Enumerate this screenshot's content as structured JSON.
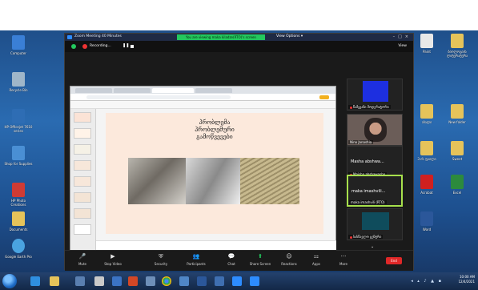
{
  "zoom": {
    "window_title": "Zoom Meeting 40 Minutes",
    "share_banner": "You are viewing maka kiladze(RTO)'s screen",
    "view_options": "View Options ▾",
    "recording_label": "Recording...",
    "view_label": "View"
  },
  "slide": {
    "title": "პრობლემა\nპრობლემური\nგამოწვევები"
  },
  "participants": [
    {
      "name": "წამყვანი მოდერატორი"
    },
    {
      "name": "Nino Janashia"
    },
    {
      "name": "Maisha abshawasho",
      "big": "Masha  abshwa..."
    },
    {
      "name": "maka  imashvili (RTO)",
      "big": "maka  imashvili..."
    },
    {
      "name": "სასწავლო ცენტრი"
    }
  ],
  "toolbar": {
    "mute": "Mute",
    "stop_video": "Stop Video",
    "security": "Security",
    "participants": "Participants",
    "participants_count": "7",
    "chat": "Chat",
    "share_screen": "Share Screen",
    "reactions": "Reactions",
    "apps": "Apps",
    "more": "More",
    "end": "End"
  },
  "desktop_icons_left": [
    {
      "label": "Computer",
      "color": "#3a7fd6"
    },
    {
      "label": "Recycle Bin",
      "color": "#9fb6c9"
    },
    {
      "label": "HP Officejet 7610 series",
      "color": "#2e6db4"
    },
    {
      "label": "Shop for Supplies",
      "color": "#4a8fd4"
    },
    {
      "label": "HP Photo Creations",
      "color": "#cf3b34"
    },
    {
      "label": "Documents",
      "color": "#e5c35a"
    },
    {
      "label": "Google Earth Pro",
      "color": "#4aa3e0"
    }
  ],
  "desktop_icons_right": [
    {
      "label": "Paint",
      "color": "#e8e8e8"
    },
    {
      "label": "ბიოლოგიის ლიტერატურა",
      "color": "#e5c35a"
    },
    {
      "label": "ახალი",
      "color": "#e5c35a"
    },
    {
      "label": "New folder",
      "color": "#e5c35a"
    },
    {
      "label": "3-ის ფაილი",
      "color": "#e5c35a"
    },
    {
      "label": "Sweet",
      "color": "#e5c35a"
    },
    {
      "label": "Acrobat",
      "color": "#cf2020"
    },
    {
      "label": "Excel",
      "color": "#2c8a3d"
    },
    {
      "label": "Word",
      "color": "#2b579a"
    }
  ],
  "taskbar": {
    "time": "10:00 AM",
    "date": "12/4/2021"
  },
  "colors": {
    "zoom_green": "#23c85d",
    "end_red": "#e02828",
    "active_speaker": "#a7e04c"
  }
}
